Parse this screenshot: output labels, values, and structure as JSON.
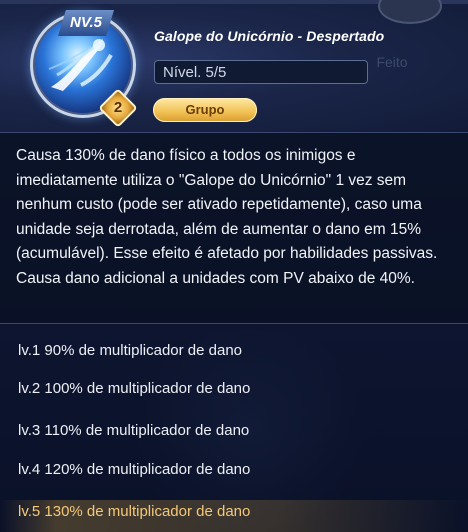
{
  "skill": {
    "level_badge": "NV.5",
    "tier": "2",
    "title": "Galope do Unicórnio - Despertado",
    "level_field": "Nível. 5/5",
    "group_label": "Grupo",
    "ghost_label": "Feito"
  },
  "description": "Causa 130% de dano físico a todos os inimigos e imediatamente utiliza o \"Galope do Unicórnio\" 1 vez sem nenhum custo (pode ser ativado repetidamente), caso uma unidade seja derrotada, além de aumentar o dano em 15% (acumulável). Esse efeito é afetado por habilidades passivas. Causa dano adicional a unidades com PV abaixo de 40%.",
  "levels": [
    {
      "label": "lv.1 90% de multiplicador de dano"
    },
    {
      "label": "lv.2 100% de multiplicador de dano"
    },
    {
      "label": "lv.3 110% de multiplicador de dano"
    },
    {
      "label": "lv.4 120% de multiplicador de dano"
    },
    {
      "label": "lv.5 130% de multiplicador de dano"
    }
  ],
  "colors": {
    "active_level": "#f4c97a",
    "group_tag": "#f3c45a",
    "background": "#0d1530"
  },
  "icons": [
    "unicorn-skill-icon",
    "tier-badge-icon"
  ]
}
